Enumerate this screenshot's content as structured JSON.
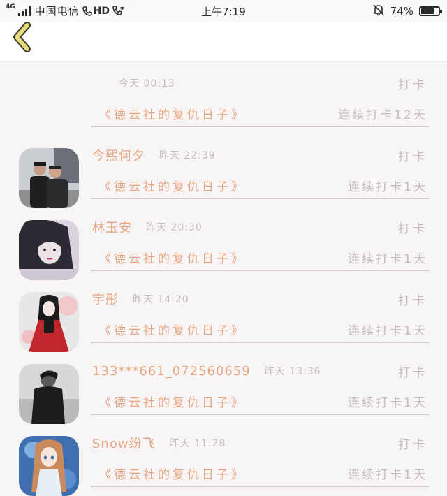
{
  "status_bar": {
    "network": "4G",
    "carrier": "中国电信",
    "hd": "HD",
    "time": "上午7:19",
    "battery": "74%",
    "battery_level": 0.74
  },
  "header": {
    "back_icon": "chevron-left-icon",
    "accent": "#e8d97a"
  },
  "colors": {
    "name": "#e7a57f",
    "muted": "#c4bcbe",
    "divider": "#d2cdcf"
  },
  "entries": [
    {
      "name": "",
      "time": "今天 00:13",
      "tag": "打卡",
      "book": "《德云社的复仇日子》",
      "streak": "连续打卡12天",
      "avatar": ""
    },
    {
      "name": "今熙何夕",
      "time": "昨天 22:39",
      "tag": "打卡",
      "book": "《德云社的复仇日子》",
      "streak": "连续打卡1天",
      "avatar": "two-men-photo"
    },
    {
      "name": "林玉安",
      "time": "昨天 20:30",
      "tag": "打卡",
      "book": "《德云社的复仇日子》",
      "streak": "连续打卡1天",
      "avatar": "girl-portrait"
    },
    {
      "name": "宇彤",
      "time": "昨天 14:20",
      "tag": "打卡",
      "book": "《德云社的复仇日子》",
      "streak": "连续打卡1天",
      "avatar": "anime-girl-red"
    },
    {
      "name": "133***661_072560659",
      "time": "昨天 13:36",
      "tag": "打卡",
      "book": "《德云社的复仇日子》",
      "streak": "连续打卡1天",
      "avatar": "man-bw"
    },
    {
      "name": "Snow纷飞",
      "time": "昨天 11:28",
      "tag": "打卡",
      "book": "《德云社的复仇日子》",
      "streak": "连续打卡1天",
      "avatar": "anime-girl-blue"
    }
  ]
}
